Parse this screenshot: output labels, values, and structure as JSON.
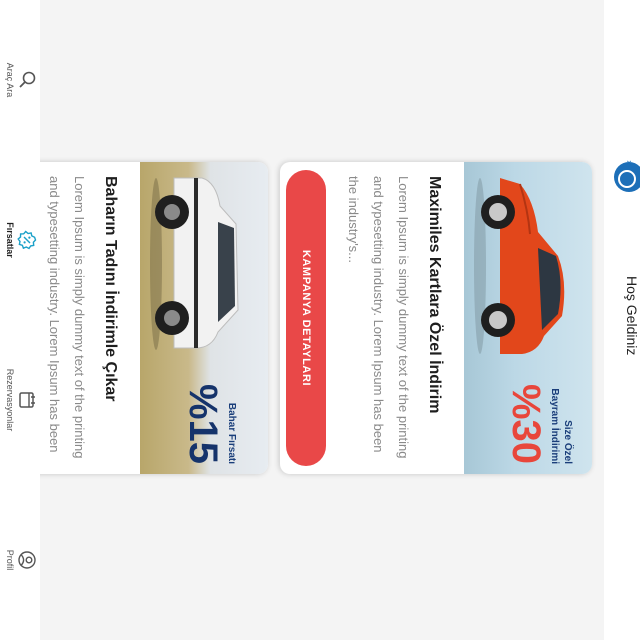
{
  "header": {
    "welcome_text": "Hoş Geldiniz",
    "logo_icon": "brand-logo-icon"
  },
  "campaigns": [
    {
      "banner_small_line1": "Size Özel",
      "banner_small_line2": "Bayram İndirimi",
      "banner_big": "%30",
      "title": "Maximiles Kartlara Özel İndirim",
      "description": "Lorem Ipsum is simply dummy text of the printing and typesetting industry. Lorem Ipsum has been the industry's...",
      "cta_label": "KAMPANYA DETAYLARI",
      "car_color": "#e2471b"
    },
    {
      "banner_small_line1": "Bahar Fırsatı",
      "banner_big": "%15",
      "title": "Baharın Tadını İndirimle Çıkar",
      "description": "Lorem Ipsum is simply dummy text of the printing and typesetting industry. Lorem Ipsum has been the industry's",
      "car_color": "#f2f2f2"
    }
  ],
  "bottom_nav": [
    {
      "label": "Araç Ara",
      "icon": "search-icon",
      "active": false
    },
    {
      "label": "Fırsatlar",
      "icon": "discount-badge-icon",
      "active": true
    },
    {
      "label": "Rezervasyonlar",
      "icon": "calendar-icon",
      "active": false
    },
    {
      "label": "Profil",
      "icon": "user-icon",
      "active": false
    }
  ],
  "colors": {
    "accent_red": "#e94848",
    "brand_blue": "#1d6fb8",
    "navy": "#15336b",
    "active_nav": "#1aa0c8"
  }
}
